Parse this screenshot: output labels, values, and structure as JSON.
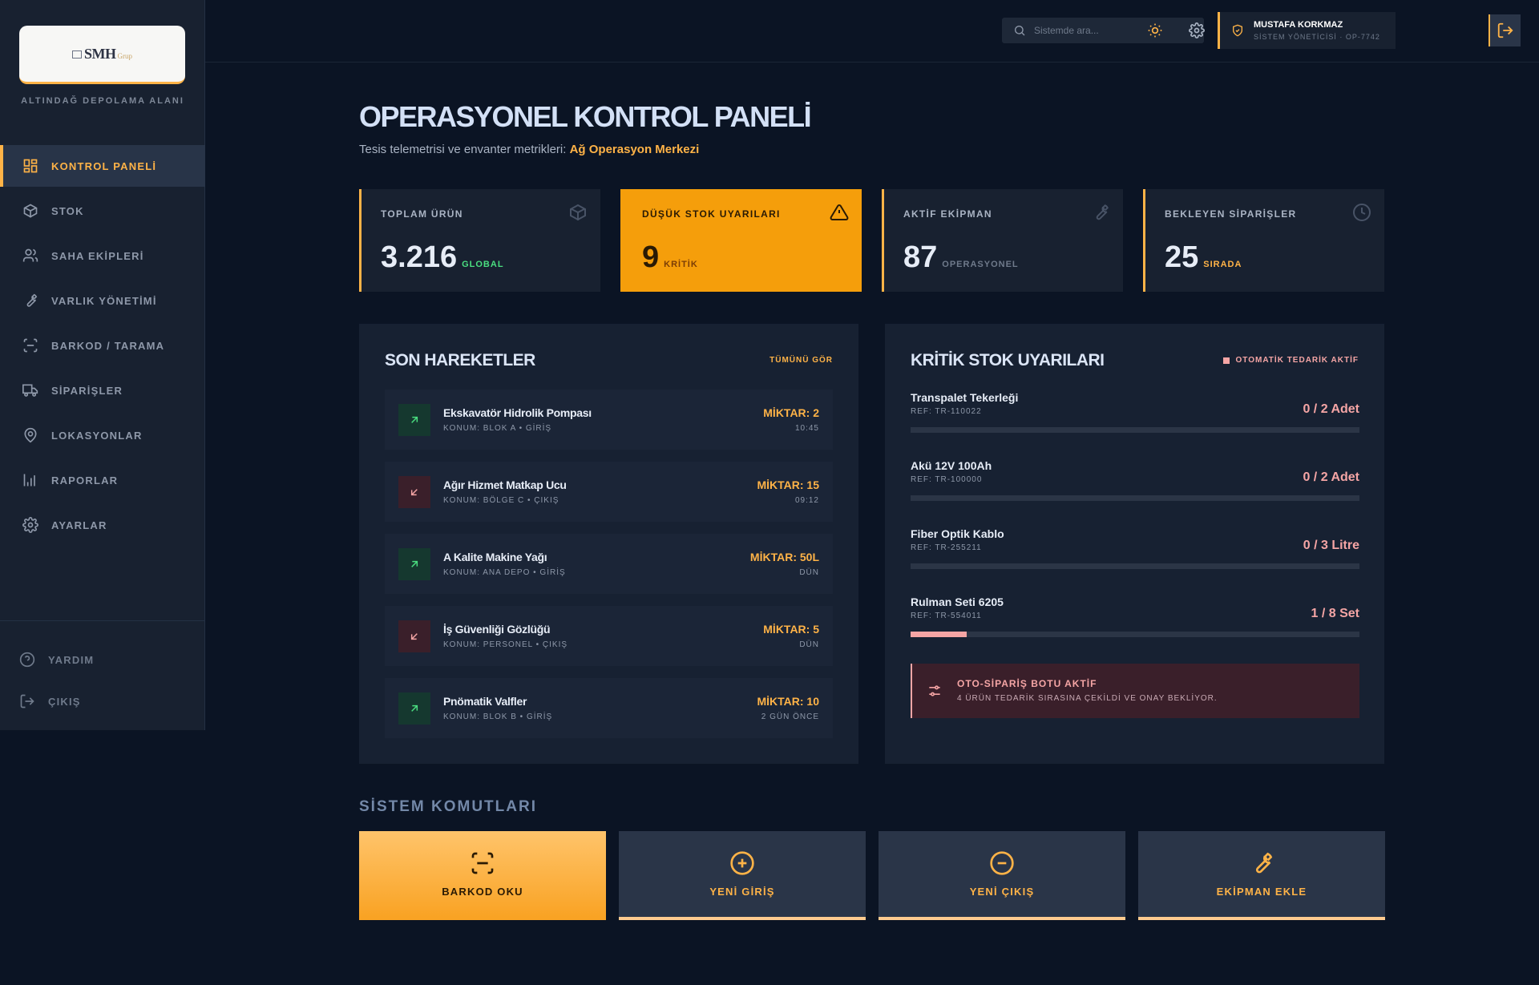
{
  "sidebar": {
    "logo": {
      "mark": "SMH",
      "sub": "Grup"
    },
    "site_name": "ALTINDAĞ DEPOLAMA ALANI",
    "items": [
      {
        "label": "KONTROL PANELİ",
        "icon": "dashboard-icon",
        "active": true
      },
      {
        "label": "STOK",
        "icon": "box-icon"
      },
      {
        "label": "SAHA EKİPLERİ",
        "icon": "users-icon"
      },
      {
        "label": "VARLIK YÖNETİMİ",
        "icon": "wrench-icon"
      },
      {
        "label": "BARKOD / TARAMA",
        "icon": "scan-icon"
      },
      {
        "label": "SİPARİŞLER",
        "icon": "truck-icon"
      },
      {
        "label": "LOKASYONLAR",
        "icon": "map-pin-icon"
      },
      {
        "label": "RAPORLAR",
        "icon": "bar-chart-icon"
      },
      {
        "label": "AYARLAR",
        "icon": "gear-icon"
      }
    ],
    "footer": [
      {
        "label": "YARDIM",
        "icon": "help-icon"
      },
      {
        "label": "ÇIKIŞ",
        "icon": "logout-icon"
      }
    ]
  },
  "topbar": {
    "search_placeholder": "Sistemde ara...",
    "user_name": "MUSTAFA KORKMAZ",
    "user_role": "SİSTEM YÖNETİCİSİ · OP-7742"
  },
  "header": {
    "title": "OPERASYONEL KONTROL PANELİ",
    "subtitle_prefix": "Tesis telemetrisi ve envanter metrikleri:",
    "subtitle_highlight": "Ağ Operasyon Merkezi"
  },
  "stats": [
    {
      "label": "TOPLAM ÜRÜN",
      "value": "3.216",
      "unit": "GLOBAL",
      "unit_color": "#4ade80",
      "icon": "cube-icon"
    },
    {
      "label": "DÜŞÜK STOK UYARILARI",
      "value": "9",
      "unit": "KRİTİK",
      "unit_color": "#7a3d06",
      "icon": "warning-icon"
    },
    {
      "label": "AKTİF EKİPMAN",
      "value": "87",
      "unit": "OPERASYONEL",
      "unit_color": "#6f7a8b",
      "icon": "wrench-icon"
    },
    {
      "label": "BEKLEYEN SİPARİŞLER",
      "value": "25",
      "unit": "SIRADA",
      "unit_color": "#ffb347",
      "icon": "clock-icon"
    }
  ],
  "movements": {
    "title": "SON HAREKETLER",
    "link": "TÜMÜNÜ GÖR",
    "items": [
      {
        "name": "Ekskavatör Hidrolik Pompası",
        "location": "KONUM: BLOK A • GİRİŞ",
        "qty": "MİKTAR: 2",
        "time": "10:45",
        "dir": "in"
      },
      {
        "name": "Ağır Hizmet Matkap Ucu",
        "location": "KONUM: BÖLGE C • ÇIKIŞ",
        "qty": "MİKTAR: 15",
        "time": "09:12",
        "dir": "out"
      },
      {
        "name": "A Kalite Makine Yağı",
        "location": "KONUM: ANA DEPO • GİRİŞ",
        "qty": "MİKTAR: 50L",
        "time": "DÜN",
        "dir": "in"
      },
      {
        "name": "İş Güvenliği Gözlüğü",
        "location": "KONUM: PERSONEL • ÇIKIŞ",
        "qty": "MİKTAR: 5",
        "time": "DÜN",
        "dir": "out"
      },
      {
        "name": "Pnömatik Valfler",
        "location": "KONUM: BLOK B • GİRİŞ",
        "qty": "MİKTAR: 10",
        "time": "2 GÜN ÖNCE",
        "dir": "in"
      }
    ]
  },
  "alerts": {
    "title": "KRİTİK STOK UYARILARI",
    "badge": "OTOMATİK TEDARİK AKTİF",
    "items": [
      {
        "name": "Transpalet Tekerleği",
        "ref": "REF: TR-110022",
        "amount": "0 / 2 Adet",
        "level": 0
      },
      {
        "name": "Akü 12V 100Ah",
        "ref": "REF: TR-100000",
        "amount": "0 / 2 Adet",
        "level": 0
      },
      {
        "name": "Fiber Optik Kablo",
        "ref": "REF: TR-255211",
        "amount": "0 / 3 Litre",
        "level": 0
      },
      {
        "name": "Rulman Seti 6205",
        "ref": "REF: TR-554011",
        "amount": "1 / 8 Set",
        "level": 0.125
      }
    ],
    "bot": {
      "title": "OTO-SİPARİŞ BOTU AKTİF",
      "desc": "4 ÜRÜN TEDARİK SIRASINA ÇEKİLDİ VE ONAY BEKLİYOR."
    }
  },
  "commands": {
    "title": "SİSTEM KOMUTLARI",
    "items": [
      {
        "label": "BARKOD OKU",
        "icon": "scan-icon"
      },
      {
        "label": "YENİ GİRİŞ",
        "icon": "plus-circle-icon"
      },
      {
        "label": "YENİ ÇIKIŞ",
        "icon": "minus-circle-icon"
      },
      {
        "label": "EKİPMAN EKLE",
        "icon": "wrench-icon"
      }
    ]
  }
}
